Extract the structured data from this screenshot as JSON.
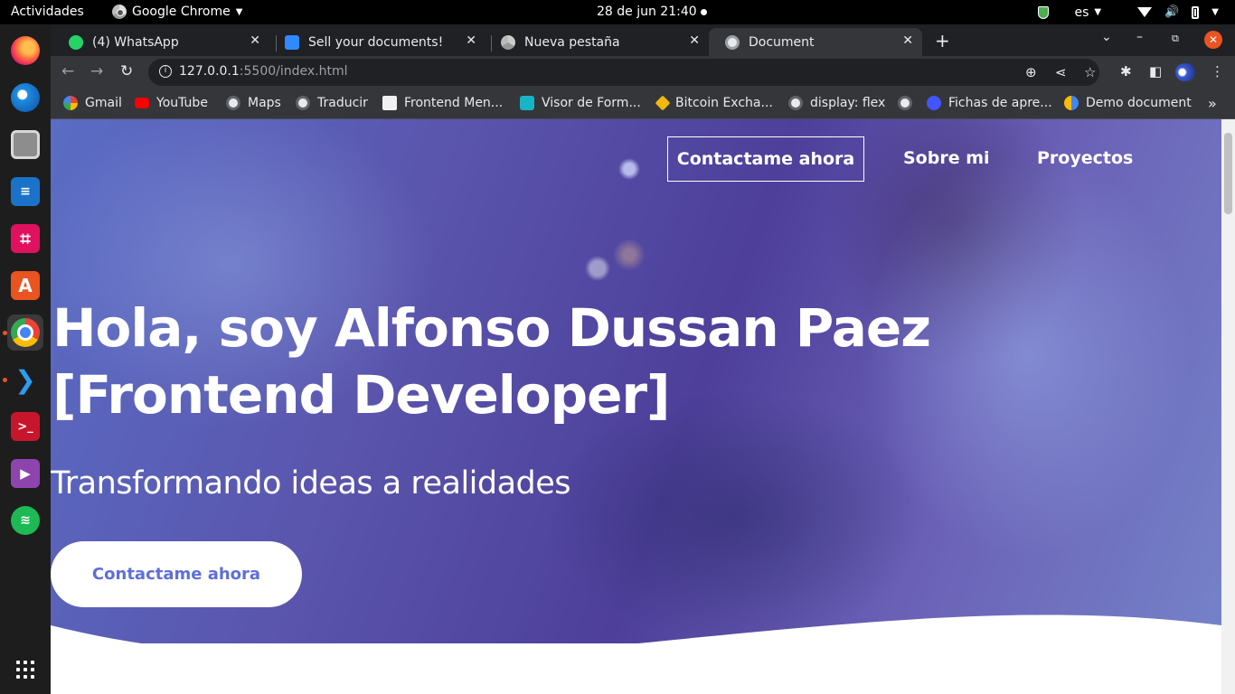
{
  "os_topbar": {
    "activities": "Actividades",
    "app_name": "Google Chrome",
    "clock": "28 de jun  21:40",
    "language": "es"
  },
  "dock": {
    "apps": [
      "firefox-icon",
      "thunderbird-icon",
      "files-icon",
      "libreoffice-writer-icon",
      "screenshot-crop-icon",
      "software-store-icon",
      "chrome-icon",
      "vscode-icon",
      "terminal-icon",
      "media-player-icon",
      "spotify-icon"
    ],
    "active": "chrome-icon"
  },
  "browser": {
    "tabs": [
      {
        "title": "(4) WhatsApp",
        "icon": "whatsapp-icon"
      },
      {
        "title": "Sell your documents!",
        "icon": "sell-icon"
      },
      {
        "title": "Nueva pestaña",
        "icon": "chrome-icon"
      },
      {
        "title": "Document",
        "icon": "globe-icon",
        "active": true
      }
    ],
    "address": {
      "host": "127.0.0.1",
      "rest": ":5500/index.html"
    },
    "bookmarks": [
      {
        "label": "Gmail",
        "icon": "gmail-icon"
      },
      {
        "label": "YouTube",
        "icon": "youtube-icon"
      },
      {
        "label": "Maps",
        "icon": "globe-icon"
      },
      {
        "label": "Traducir",
        "icon": "globe-icon"
      },
      {
        "label": "Frontend Men...",
        "icon": "frontend-mentor-icon"
      },
      {
        "label": "Visor de Form...",
        "icon": "form-viewer-icon"
      },
      {
        "label": "Bitcoin Excha...",
        "icon": "binance-icon"
      },
      {
        "label": "display: flex",
        "icon": "globe-icon"
      },
      {
        "label": "",
        "icon": "globe-icon"
      },
      {
        "label": "Fichas de apre...",
        "icon": "quizlet-icon"
      },
      {
        "label": "Demo document",
        "icon": "google-docs-icon"
      }
    ]
  },
  "page": {
    "nav": {
      "contact": "Contactame ahora",
      "about": "Sobre mi",
      "projects": "Proyectos"
    },
    "hero": {
      "title_line1": "Hola, soy Alfonso Dussan Paez",
      "title_line2": "[Frontend Developer]",
      "subtitle": "Transformando ideas a realidades",
      "cta": "Contactame ahora"
    },
    "colors": {
      "hero_overlay": "#5a55ad",
      "cta_text": "#5f6fd6"
    }
  }
}
